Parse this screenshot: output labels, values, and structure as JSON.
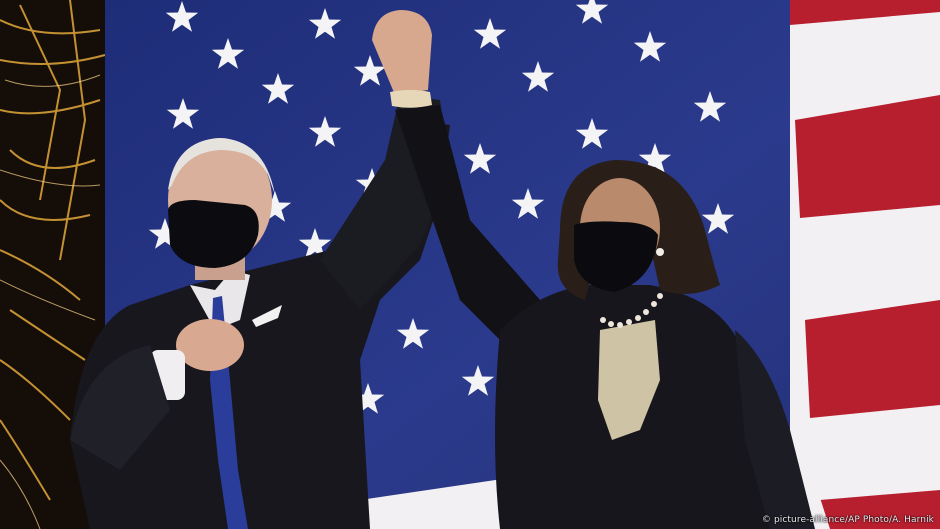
{
  "photo": {
    "credit": "© picture-alliance/AP Photo/A. Harnik",
    "colors": {
      "flag_blue": "#2b3a8c",
      "flag_red": "#b81f2e",
      "flag_white": "#f2f0f2",
      "suit": "#17171d",
      "fireworks": "#e3a93a"
    }
  }
}
